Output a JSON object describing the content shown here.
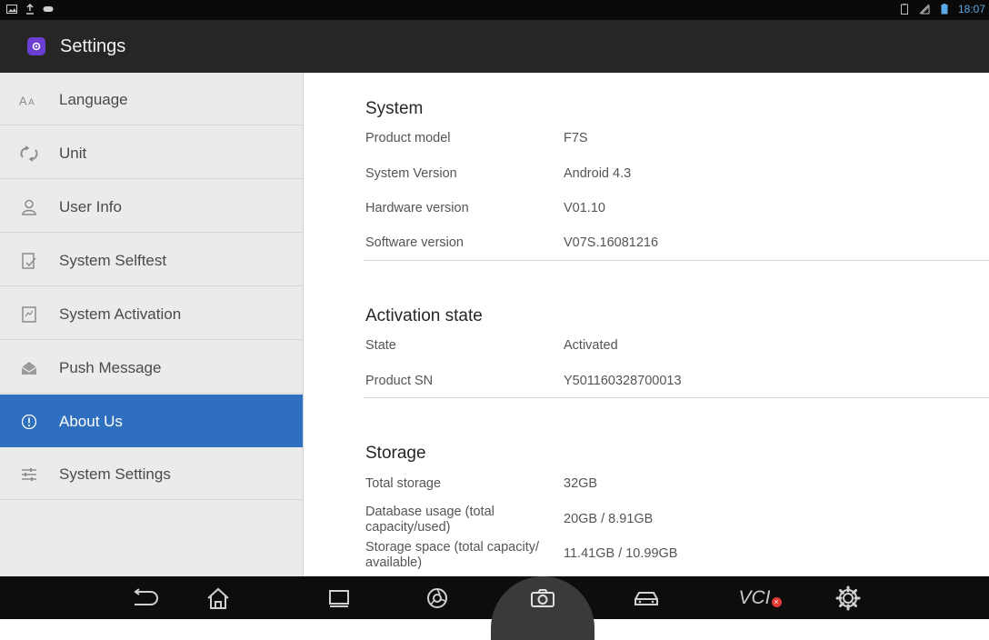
{
  "window": {
    "title": "Settings",
    "time": "18:07"
  },
  "sidebar": {
    "items": [
      {
        "label": "Language",
        "icon": "font-size-icon"
      },
      {
        "label": "Unit",
        "icon": "unit-icon"
      },
      {
        "label": "User Info",
        "icon": "user-icon"
      },
      {
        "label": "System Selftest",
        "icon": "selftest-icon"
      },
      {
        "label": "System Activation",
        "icon": "activation-icon"
      },
      {
        "label": "Push Message",
        "icon": "mail-icon"
      },
      {
        "label": "About Us",
        "icon": "info-icon",
        "active": true
      },
      {
        "label": "System Settings",
        "icon": "sliders-icon"
      }
    ]
  },
  "main": {
    "system": {
      "title": "System",
      "rows": [
        {
          "label": "Product model",
          "value": "F7S"
        },
        {
          "label": "System Version",
          "value": "Android 4.3"
        },
        {
          "label": "Hardware version",
          "value": "V01.10"
        },
        {
          "label": "Software version",
          "value": "V07S.16081216"
        }
      ]
    },
    "activation": {
      "title": "Activation state",
      "rows": [
        {
          "label": "State",
          "value": "Activated"
        },
        {
          "label": "Product SN",
          "value": "Y501160328700013"
        }
      ]
    },
    "storage": {
      "title": "Storage",
      "rows": [
        {
          "label": "Total storage",
          "value": "32GB"
        },
        {
          "label": "Database usage (total capacity/used)",
          "value": "20GB / 8.91GB"
        },
        {
          "label": "Storage space (total capacity/ available)",
          "value": "11.41GB / 10.99GB"
        }
      ]
    }
  },
  "navbar": {
    "vci_label": "VCI"
  },
  "colors": {
    "accent": "#2f6fbf",
    "titlebar": "#262626",
    "sidebar_bg": "#ebebeb",
    "app_icon": "#6a3fd1"
  }
}
